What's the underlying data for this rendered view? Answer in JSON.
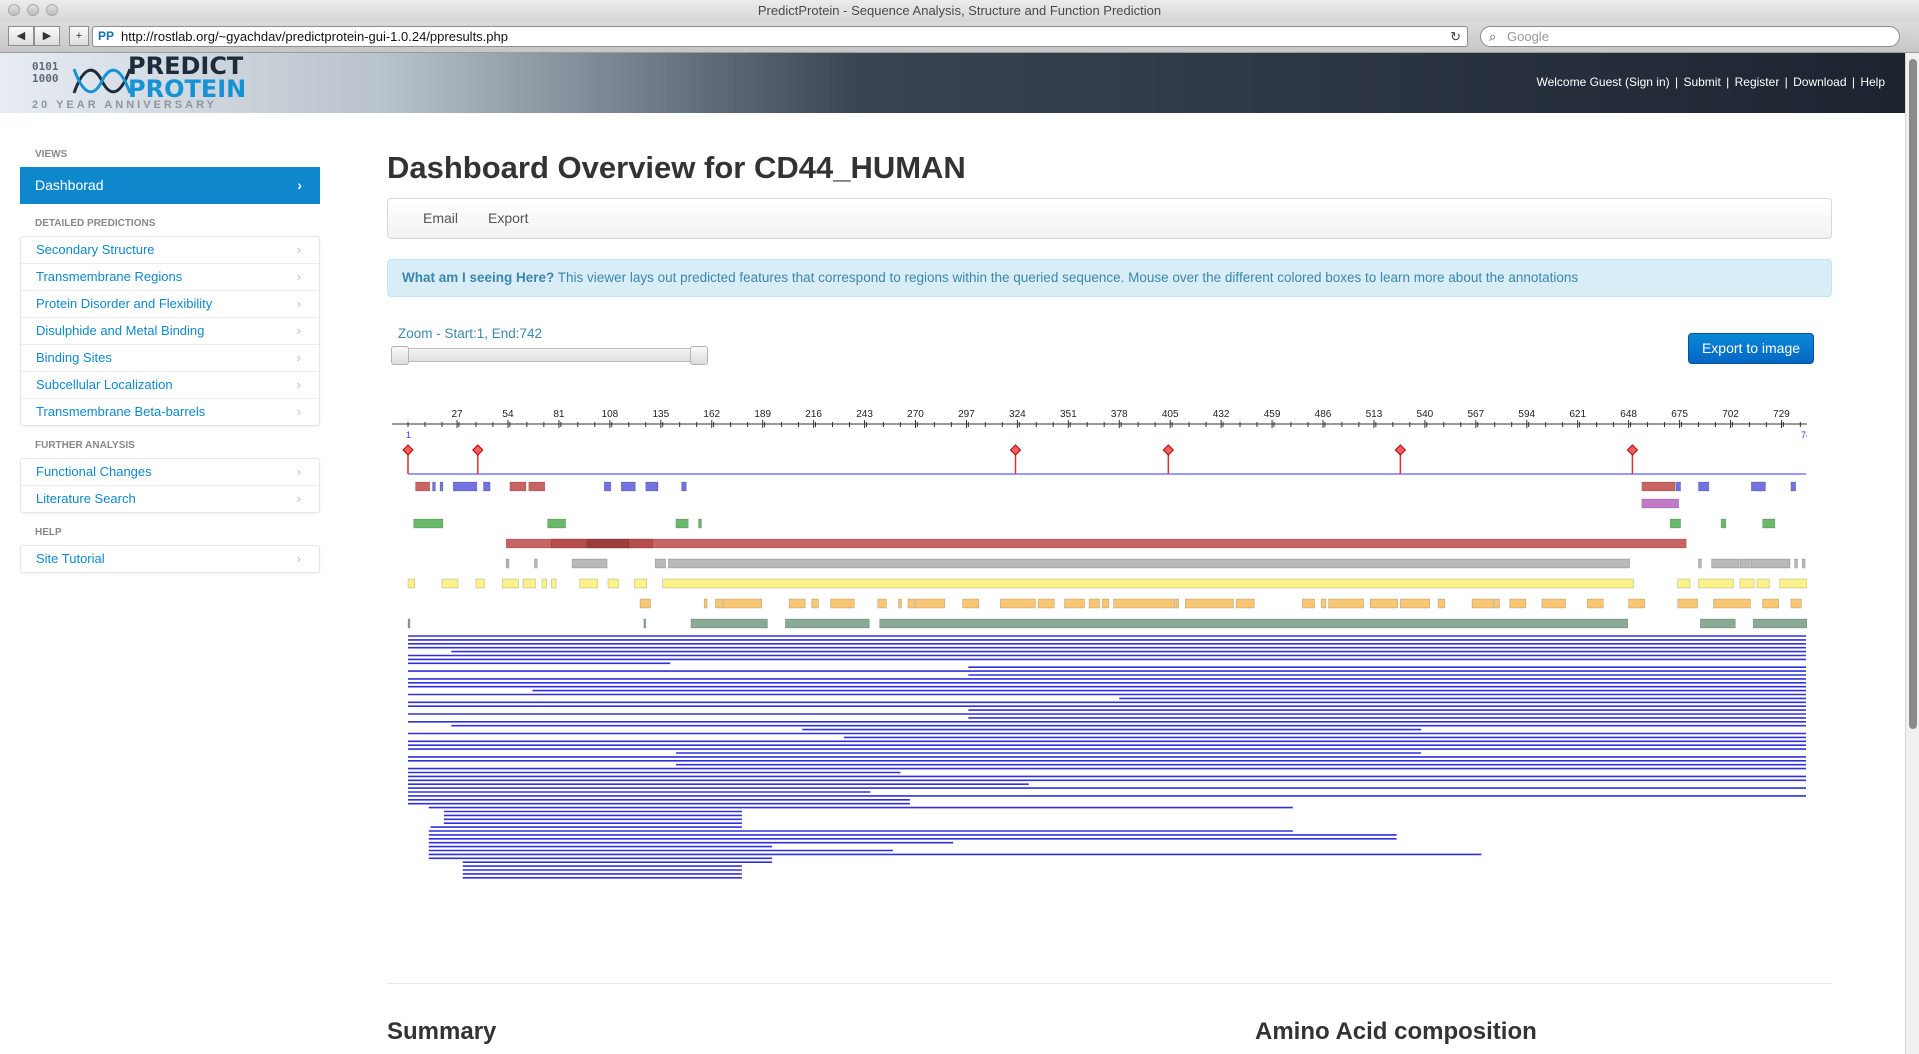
{
  "browser": {
    "window_title": "PredictProtein - Sequence Analysis, Structure and Function Prediction",
    "back": "◀",
    "forward": "▶",
    "add_tab": "+",
    "favicon": "PP",
    "url": "http://rostlab.org/~gyachdav/predictprotein-gui-1.0.24/ppresults.php",
    "search_placeholder": "Google"
  },
  "site": {
    "logo_bits": "0101\n1000",
    "logo_line1": "PREDICT",
    "logo_line2": "PROTEIN",
    "logo_sub": "20 YEAR ANNIVERSARY",
    "toplinks": {
      "welcome": "Welcome Guest (Sign in)",
      "submit": "Submit",
      "register": "Register",
      "download": "Download",
      "help": "Help",
      "separator": "|"
    }
  },
  "sidebar": {
    "views_header": "VIEWS",
    "active_item": "Dashborad",
    "detailed_header": "DETAILED PREDICTIONS",
    "detailed_items": [
      "Secondary Structure",
      "Transmembrane Regions",
      "Protein Disorder and Flexibility",
      "Disulphide and Metal Binding",
      "Binding Sites",
      "Subcellular Localization",
      "Transmembrane Beta-barrels"
    ],
    "further_header": "FURTHER ANALYSIS",
    "further_items": [
      "Functional Changes",
      "Literature Search"
    ],
    "help_header": "HELP",
    "help_items": [
      "Site Tutorial"
    ]
  },
  "main": {
    "title": "Dashboard Overview for CD44_HUMAN",
    "subnav": {
      "email": "Email",
      "export": "Export"
    },
    "info_strong": "What am I seeing Here?",
    "info_text": " This viewer lays out predicted features that correspond to regions within the queried sequence. Mouse over the different colored boxes to learn more about the annotations",
    "zoom_label": "Zoom - Start:1, End:742",
    "export_button": "Export to image",
    "summary_heading": "Summary",
    "aa_heading": "Amino Acid composition"
  },
  "viewer": {
    "seq_start": 1,
    "seq_end": 742,
    "start_label": "1",
    "end_label": "742",
    "tick_labels": [
      27,
      54,
      81,
      108,
      135,
      162,
      189,
      216,
      243,
      270,
      297,
      324,
      351,
      378,
      405,
      432,
      459,
      486,
      513,
      540,
      567,
      594,
      621,
      648,
      675,
      702,
      729
    ],
    "colors": {
      "axis": "#333333",
      "seq_line": "#3333ff",
      "marker": "#e03030",
      "red_box": "#c86464",
      "blue_box": "#7272e0",
      "purple_box": "#c07ac8",
      "green_box": "#6ab96a",
      "gray_box": "#b9b9b9",
      "yellow_box": "#fbf38a",
      "orange_box": "#f9c774",
      "slate_box": "#8aaa96",
      "hit_line": "#3030dd"
    },
    "markers": [
      1,
      38,
      323,
      404,
      527,
      650
    ],
    "tracks": [
      {
        "name": "red",
        "color": "red_box",
        "segments": [
          [
            5,
            12
          ],
          [
            55,
            63
          ],
          [
            65,
            73
          ],
          [
            655,
            672
          ],
          [
            716,
            718
          ]
        ]
      },
      {
        "name": "blue",
        "color": "blue_box",
        "segments": [
          [
            14,
            15
          ],
          [
            18,
            19
          ],
          [
            25,
            37
          ],
          [
            41,
            44
          ],
          [
            105,
            108
          ],
          [
            114,
            121
          ],
          [
            127,
            133
          ],
          [
            146,
            148
          ],
          [
            673,
            675
          ],
          [
            685,
            690
          ],
          [
            713,
            720
          ],
          [
            734,
            736
          ]
        ]
      },
      {
        "name": "purple",
        "color": "purple_box",
        "segments": [
          [
            655,
            674
          ]
        ]
      },
      {
        "name": "green",
        "color": "green_box",
        "segments": [
          [
            4,
            19
          ],
          [
            75,
            84
          ],
          [
            143,
            149
          ],
          [
            155,
            156
          ],
          [
            670,
            675
          ],
          [
            697,
            699
          ],
          [
            719,
            725
          ]
        ]
      },
      {
        "name": "dark-red",
        "color": "red_box",
        "segments": [
          [
            53,
            678
          ],
          [
            77,
            95
          ],
          [
            96,
            118
          ],
          [
            118,
            130
          ]
        ]
      },
      {
        "name": "gray",
        "color": "gray_box",
        "segments": [
          [
            53,
            54
          ],
          [
            68,
            69
          ],
          [
            88,
            106
          ],
          [
            132,
            137
          ],
          [
            139,
            648
          ],
          [
            685,
            686
          ],
          [
            692,
            706
          ],
          [
            707,
            712
          ],
          [
            713,
            733
          ],
          [
            736,
            737
          ],
          [
            740,
            741
          ]
        ]
      },
      {
        "name": "yellow",
        "color": "yellow_box",
        "segments": [
          [
            1,
            4
          ],
          [
            19,
            27
          ],
          [
            37,
            41
          ],
          [
            51,
            59
          ],
          [
            62,
            68
          ],
          [
            72,
            74
          ],
          [
            77,
            79
          ],
          [
            92,
            101
          ],
          [
            107,
            112
          ],
          [
            121,
            127
          ],
          [
            136,
            650
          ],
          [
            674,
            680
          ],
          [
            685,
            703
          ],
          [
            707,
            714
          ],
          [
            716,
            722
          ],
          [
            728,
            742
          ]
        ]
      },
      {
        "name": "orange",
        "color": "orange_box",
        "segments": [
          [
            124,
            129
          ],
          [
            158,
            159
          ],
          [
            164,
            167
          ],
          [
            168,
            188
          ],
          [
            203,
            211
          ],
          [
            215,
            218
          ],
          [
            225,
            237
          ],
          [
            250,
            254
          ],
          [
            261,
            262
          ],
          [
            266,
            269
          ],
          [
            270,
            285
          ],
          [
            295,
            303
          ],
          [
            315,
            333
          ],
          [
            335,
            343
          ],
          [
            349,
            359
          ],
          [
            362,
            367
          ],
          [
            369,
            372
          ],
          [
            375,
            407
          ],
          [
            408,
            409
          ],
          [
            413,
            438
          ],
          [
            440,
            449
          ],
          [
            475,
            481
          ],
          [
            485,
            487
          ],
          [
            489,
            507
          ],
          [
            511,
            525
          ],
          [
            527,
            542
          ],
          [
            547,
            550
          ],
          [
            565,
            576
          ],
          [
            577,
            579
          ],
          [
            585,
            593
          ],
          [
            602,
            614
          ],
          [
            626,
            634
          ],
          [
            648,
            656
          ],
          [
            674,
            684
          ],
          [
            693,
            712
          ],
          [
            719,
            727
          ],
          [
            734,
            739
          ]
        ]
      },
      {
        "name": "slate",
        "color": "slate_box",
        "segments": [
          [
            1,
            1
          ],
          [
            126,
            126
          ],
          [
            151,
            191
          ],
          [
            201,
            245
          ],
          [
            251,
            647
          ],
          [
            686,
            704
          ],
          [
            714,
            742
          ]
        ]
      }
    ],
    "hits": [
      [
        1,
        742
      ],
      [
        1,
        742
      ],
      [
        1,
        742
      ],
      [
        1,
        742
      ],
      [
        24,
        742
      ],
      [
        1,
        742
      ],
      [
        1,
        742
      ],
      [
        1,
        140
      ],
      [
        298,
        742
      ],
      [
        1,
        742
      ],
      [
        298,
        742
      ],
      [
        1,
        742
      ],
      [
        1,
        742
      ],
      [
        1,
        742
      ],
      [
        67,
        742
      ],
      [
        1,
        742
      ],
      [
        378,
        742
      ],
      [
        1,
        742
      ],
      [
        1,
        742
      ],
      [
        298,
        742
      ],
      [
        1,
        742
      ],
      [
        298,
        742
      ],
      [
        1,
        742
      ],
      [
        24,
        742
      ],
      [
        210,
        538
      ],
      [
        1,
        742
      ],
      [
        232,
        742
      ],
      [
        1,
        742
      ],
      [
        1,
        742
      ],
      [
        1,
        742
      ],
      [
        143,
        538
      ],
      [
        1,
        742
      ],
      [
        1,
        742
      ],
      [
        143,
        742
      ],
      [
        1,
        742
      ],
      [
        1,
        262
      ],
      [
        1,
        742
      ],
      [
        1,
        742
      ],
      [
        1,
        330
      ],
      [
        1,
        742
      ],
      [
        1,
        246
      ],
      [
        1,
        742
      ],
      [
        1,
        267
      ],
      [
        1,
        267
      ],
      [
        12,
        470
      ],
      [
        20,
        178
      ],
      [
        20,
        178
      ],
      [
        20,
        178
      ],
      [
        20,
        178
      ],
      [
        13,
        178
      ],
      [
        12,
        470
      ],
      [
        12,
        525
      ],
      [
        12,
        525
      ],
      [
        12,
        290
      ],
      [
        12,
        194
      ],
      [
        12,
        258
      ],
      [
        12,
        570
      ],
      [
        12,
        194
      ],
      [
        30,
        194
      ],
      [
        30,
        178
      ],
      [
        30,
        178
      ],
      [
        30,
        178
      ],
      [
        30,
        178
      ]
    ],
    "hits_right": [
      [
        418,
        742
      ],
      [
        418,
        742
      ],
      [
        418,
        742
      ],
      [
        418,
        742
      ],
      [
        418,
        742
      ],
      [
        418,
        742
      ],
      [
        418,
        742
      ],
      [
        418,
        742
      ],
      [
        418,
        742
      ],
      [
        418,
        742
      ],
      [
        418,
        742
      ],
      [
        418,
        742
      ],
      [
        418,
        742
      ],
      [
        418,
        742
      ],
      [
        418,
        742
      ],
      [
        418,
        742
      ],
      [
        418,
        742
      ],
      [
        418,
        742
      ],
      [
        418,
        742
      ],
      [
        418,
        742
      ],
      [
        418,
        742
      ],
      [
        418,
        742
      ],
      [
        418,
        742
      ],
      [
        418,
        742
      ],
      [
        418,
        742
      ],
      [
        418,
        742
      ],
      [
        418,
        742
      ],
      [
        418,
        742
      ],
      [
        418,
        742
      ],
      [
        418,
        742
      ],
      [
        418,
        742
      ],
      [
        418,
        742
      ],
      [
        418,
        742
      ],
      [
        418,
        742
      ],
      [
        418,
        742
      ],
      [
        418,
        742
      ],
      [
        418,
        742
      ],
      [
        418,
        742
      ],
      [
        418,
        742
      ],
      [
        418,
        742
      ],
      [
        418,
        742
      ],
      [
        418,
        742
      ],
      [
        418,
        742
      ],
      [
        418,
        742
      ]
    ]
  }
}
